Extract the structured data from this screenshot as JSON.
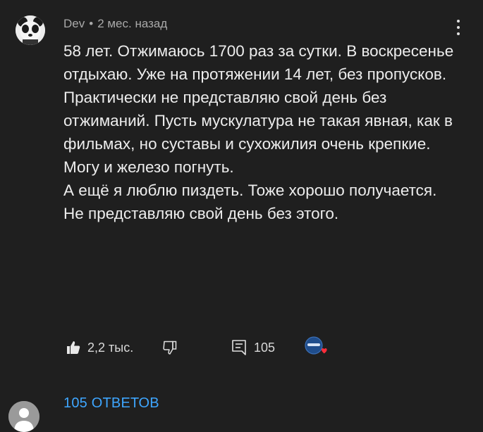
{
  "comment": {
    "author": "Dev",
    "separator": "•",
    "time": "2 мес. назад",
    "lines": [
      "58 лет. Отжимаюсь 1700 раз за сутки. В воскресенье отдыхаю. Уже на протяжении 14 лет, без пропусков. Практически не представляю свой день без отжиманий. Пусть мускулатура не такая явная, как в фильмах, но суставы и сухожилия очень крепкие. Могу и железо погнуть.",
      "А ещё я люблю пиздеть. Тоже хорошо получается. Не представляю свой день без этого."
    ]
  },
  "actions": {
    "like_count": "2,2 тыс.",
    "reply_count": "105"
  },
  "replies_link": "105 ОТВЕТОВ",
  "icons": {
    "menu": "kebab-menu-icon",
    "like": "thumbs-up-icon",
    "dislike": "thumbs-down-icon",
    "reply": "comment-icon",
    "creator_heart": "creator-heart-icon"
  },
  "colors": {
    "background": "#1f1f1f",
    "link": "#3ea6ff",
    "heart": "#ff2d3a"
  }
}
